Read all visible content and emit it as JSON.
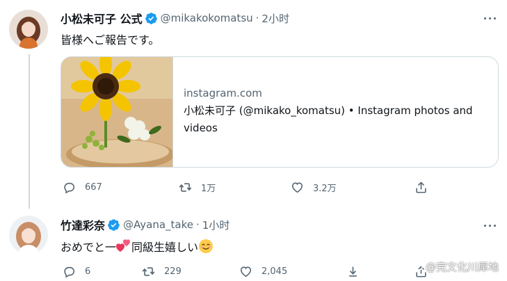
{
  "tweets": [
    {
      "display_name": "小松未可子 公式",
      "handle": "@mikakokomatsu",
      "separator": "·",
      "time": "2小时",
      "text": "皆様へご報告です。",
      "card": {
        "domain": "instagram.com",
        "title": "小松未可子 (@mikako_komatsu) • Instagram photos and videos"
      },
      "actions": {
        "reply_count": "667",
        "retweet_count": "1万",
        "like_count": "3.2万"
      }
    },
    {
      "display_name": "竹達彩奈",
      "handle": "@Ayana_take",
      "separator": "·",
      "time": "1小时",
      "text_before": "おめでと一",
      "text_after": "同級生嬉しい",
      "actions": {
        "reply_count": "6",
        "retweet_count": "229",
        "like_count": "2,045"
      }
    }
  ],
  "watermark": "@完文化川犀地",
  "colors": {
    "verified": "#1d9bf0",
    "secondary_text": "#536471",
    "border": "#cfd9de"
  },
  "icons": {
    "verified": "verified-badge-icon",
    "more": "more-horizontal-icon",
    "reply": "reply-icon",
    "retweet": "retweet-icon",
    "like": "heart-icon",
    "share": "share-icon",
    "emoji_heart": "two-hearts-emoji",
    "emoji_smile": "smiling-face-emoji"
  }
}
